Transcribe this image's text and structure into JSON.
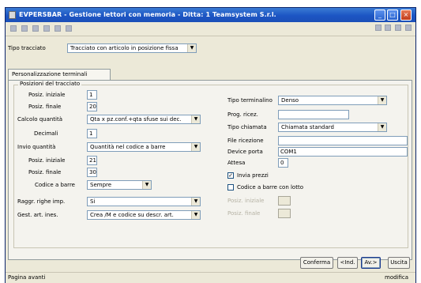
{
  "window": {
    "title": "EVPERSBAR - Gestione lettori con memoria - Ditta:   1 Teamsystem S.r.l.",
    "controls": {
      "minimize": "_",
      "maximize": "□",
      "close": "×"
    }
  },
  "toolbar": {
    "left_icons": [
      "save-icon",
      "print-icon",
      "export-icon",
      "image-icon",
      "mail-icon",
      "user-icon"
    ],
    "right_icons": [
      "dropdown-icon",
      "search-icon",
      "help-icon",
      "settings-icon"
    ]
  },
  "tracciato": {
    "label": "Tipo tracciato",
    "value": "Tracciato con articolo in posizione fissa"
  },
  "tab": {
    "label": "Personalizzazione terminali"
  },
  "group": {
    "label": "Posizioni del tracciato"
  },
  "left": {
    "pos_iniziale": {
      "label": "Posiz. iniziale",
      "value": "1"
    },
    "pos_finale": {
      "label": "Posiz. finale",
      "value": "20"
    },
    "calcolo_quantita": {
      "label": "Calcolo quantità",
      "value": "Qta x pz.conf.+qta sfuse sui dec."
    },
    "decimali": {
      "label": "Decimali",
      "value": "1"
    },
    "invio_quantita": {
      "label": "Invio quantità",
      "value": "Quantità nel codice a barre"
    },
    "pos_iniziale2": {
      "label": "Posiz. iniziale",
      "value": "21"
    },
    "pos_finale2": {
      "label": "Posiz. finale",
      "value": "30"
    },
    "codice_barre": {
      "label": "Codice a barre",
      "value": "Sempre"
    },
    "raggr_righe": {
      "label": "Raggr. righe imp.",
      "value": "Si"
    },
    "gest_art": {
      "label": "Gest. art. ines.",
      "value": "Crea /M e codice su descr. art."
    }
  },
  "right": {
    "tipo_terminalino": {
      "label": "Tipo terminalino",
      "value": "Denso"
    },
    "prog_ricez": {
      "label": "Prog. ricez.",
      "value": ""
    },
    "tipo_chiamata": {
      "label": "Tipo chiamata",
      "value": "Chiamata standard"
    },
    "file_ricezione": {
      "label": "File ricezione",
      "value": ""
    },
    "device_porta": {
      "label": "Device porta",
      "value": "COM1"
    },
    "attesa": {
      "label": "Attesa",
      "value": "0"
    },
    "invia_prezzi": {
      "label": "Invia prezzi",
      "checked": true
    },
    "codice_lotto": {
      "label": "Codice a barre con lotto",
      "checked": false
    },
    "posiz_iniz": {
      "label": "Posiz. iniziale",
      "value": ""
    },
    "posiz_fin": {
      "label": "Posiz. finale",
      "value": ""
    }
  },
  "footer": {
    "conferma": "Conferma",
    "ind": "<Ind.",
    "av": "Av.>",
    "uscita": "Uscita"
  },
  "status": {
    "left": "Pagina avanti",
    "right": "modifica"
  }
}
